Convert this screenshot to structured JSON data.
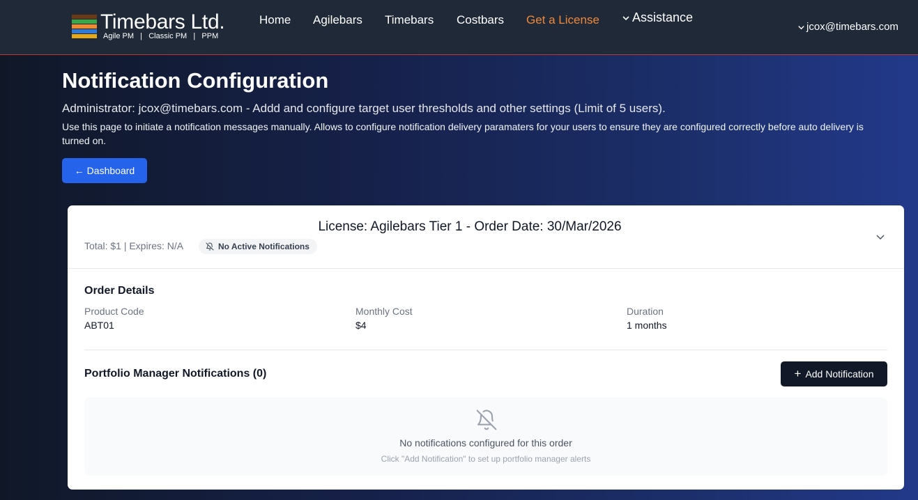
{
  "brand": {
    "name": "Timebars Ltd.",
    "tagline": "Agile PM   |   Classic PM   |   PPM",
    "bar_colors": [
      "#6b3a14",
      "#3aa64a",
      "#f08a2c",
      "#2f7ad6",
      "#e8a81c"
    ]
  },
  "nav": {
    "items": [
      "Home",
      "Agilebars",
      "Timebars",
      "Costbars",
      "Get a License"
    ],
    "assistance": "Assistance",
    "user": "jcox@timebars.com"
  },
  "page": {
    "title": "Notification Configuration",
    "admin_line": "Administrator: jcox@timebars.com - Addd and configure target user thresholds and other settings (Limit of 5 users).",
    "description": "Use this page to initiate a notification messages manually. Allows to configure notification delivery paramaters for your users to ensure they are configured correctly before auto delivery is turned on.",
    "dashboard_button": "← Dashboard"
  },
  "license": {
    "title": "License: Agilebars Tier 1 - Order Date: 30/Mar/2026",
    "meta": "Total: $1 | Expires: N/A",
    "badge": "No Active Notifications",
    "order_details_title": "Order Details",
    "details": [
      {
        "label": "Product Code",
        "value": "ABT01"
      },
      {
        "label": "Monthly Cost",
        "value": "$4"
      },
      {
        "label": "Duration",
        "value": "1 months"
      }
    ],
    "pm_title": "Portfolio Manager Notifications (0)",
    "add_button": "Add Notification",
    "empty_title": "No notifications configured for this order",
    "empty_hint": "Click \"Add Notification\" to set up portfolio manager alerts"
  },
  "colors": {
    "accent_orange": "#f0883a",
    "primary_blue": "#2563eb",
    "dark_button": "#111827"
  }
}
